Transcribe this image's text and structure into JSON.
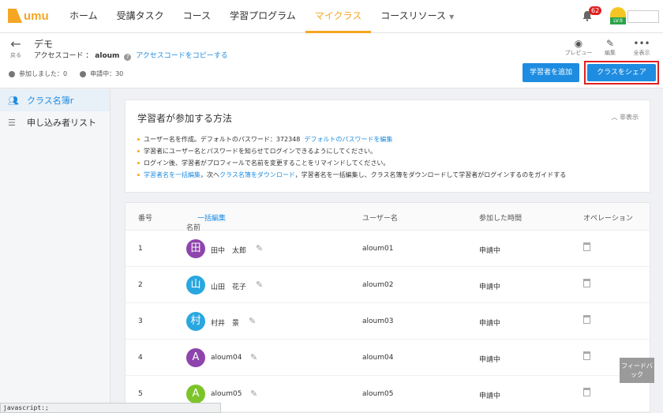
{
  "brand": {
    "logo_text": "umu",
    "color": "#f5a623"
  },
  "nav": {
    "items": [
      {
        "label": "ホーム"
      },
      {
        "label": "受講タスク"
      },
      {
        "label": "コース"
      },
      {
        "label": "学習プログラム"
      },
      {
        "label": "マイクラス",
        "active": true
      },
      {
        "label": "コースリソース",
        "has_dropdown": true
      }
    ],
    "notification_count": "62",
    "level": "LV.9"
  },
  "header": {
    "back_label": "戻る",
    "class_title": "デモ",
    "access_code_label": "アクセスコード ：",
    "access_code": "aloum",
    "copy_link": "アクセスコードをコピーする",
    "joined": "参加しました：0",
    "pending": "申請中：30",
    "tools": [
      {
        "icon": "eye-icon",
        "label": "プレビュー"
      },
      {
        "icon": "edit-icon",
        "label": "編集"
      },
      {
        "icon": "more-icon",
        "label": "全表示"
      }
    ],
    "add_learner_button": "学習者を追加",
    "share_class_button": "クラスをシェア"
  },
  "sidebar": {
    "items": [
      {
        "label": "クラス名簿r",
        "icon": "users-icon",
        "active": true
      },
      {
        "label": "申し込み者リスト",
        "icon": "list-icon"
      }
    ]
  },
  "how_to": {
    "title": "学習者が参加する方法",
    "hide_label": "非表示",
    "step1_prefix": "ユーザー名を作成。デフォルトのパスワード：372348",
    "step1_link": "デフォルトのパスワードを編集",
    "step2": "学習者にユーザー名とパスワードを知らせてログインできるようにしてください。",
    "step3": "ログイン後、学習者がプロフィールで名前を変更することをリマインドしてください。",
    "step4_link1": "学習者名を一括編集",
    "step4_mid": "，次へ",
    "step4_link2": "クラス名簿をダウンロード",
    "step4_suffix": "，学習者名を一括編集し、クラス名簿をダウンロードして学習者がログインするのをガイドする"
  },
  "table": {
    "headers": {
      "no": "番号",
      "name": "名前",
      "bulk_edit": "一括編集",
      "username": "ユーザー名",
      "joined_time": "参加した時間",
      "operation": "オペレーション"
    },
    "rows": [
      {
        "no": "1",
        "avatar": "田",
        "avatar_color": "#8e44ad",
        "name": "田中　太郎",
        "username": "aloum01",
        "status": "申請中"
      },
      {
        "no": "2",
        "avatar": "山",
        "avatar_color": "#2aa7e0",
        "name": "山田　花子",
        "username": "aloum02",
        "status": "申請中"
      },
      {
        "no": "3",
        "avatar": "村",
        "avatar_color": "#2aa7e0",
        "name": "村井　景",
        "username": "aloum03",
        "status": "申請中"
      },
      {
        "no": "4",
        "avatar": "A",
        "avatar_color": "#8e44ad",
        "name": "aloum04",
        "username": "aloum04",
        "status": "申請中"
      },
      {
        "no": "5",
        "avatar": "A",
        "avatar_color": "#7cc42a",
        "name": "aloum05",
        "username": "aloum05",
        "status": "申請中"
      }
    ]
  },
  "feedback_label": "フィードバック",
  "status_bar": "javascript:;"
}
